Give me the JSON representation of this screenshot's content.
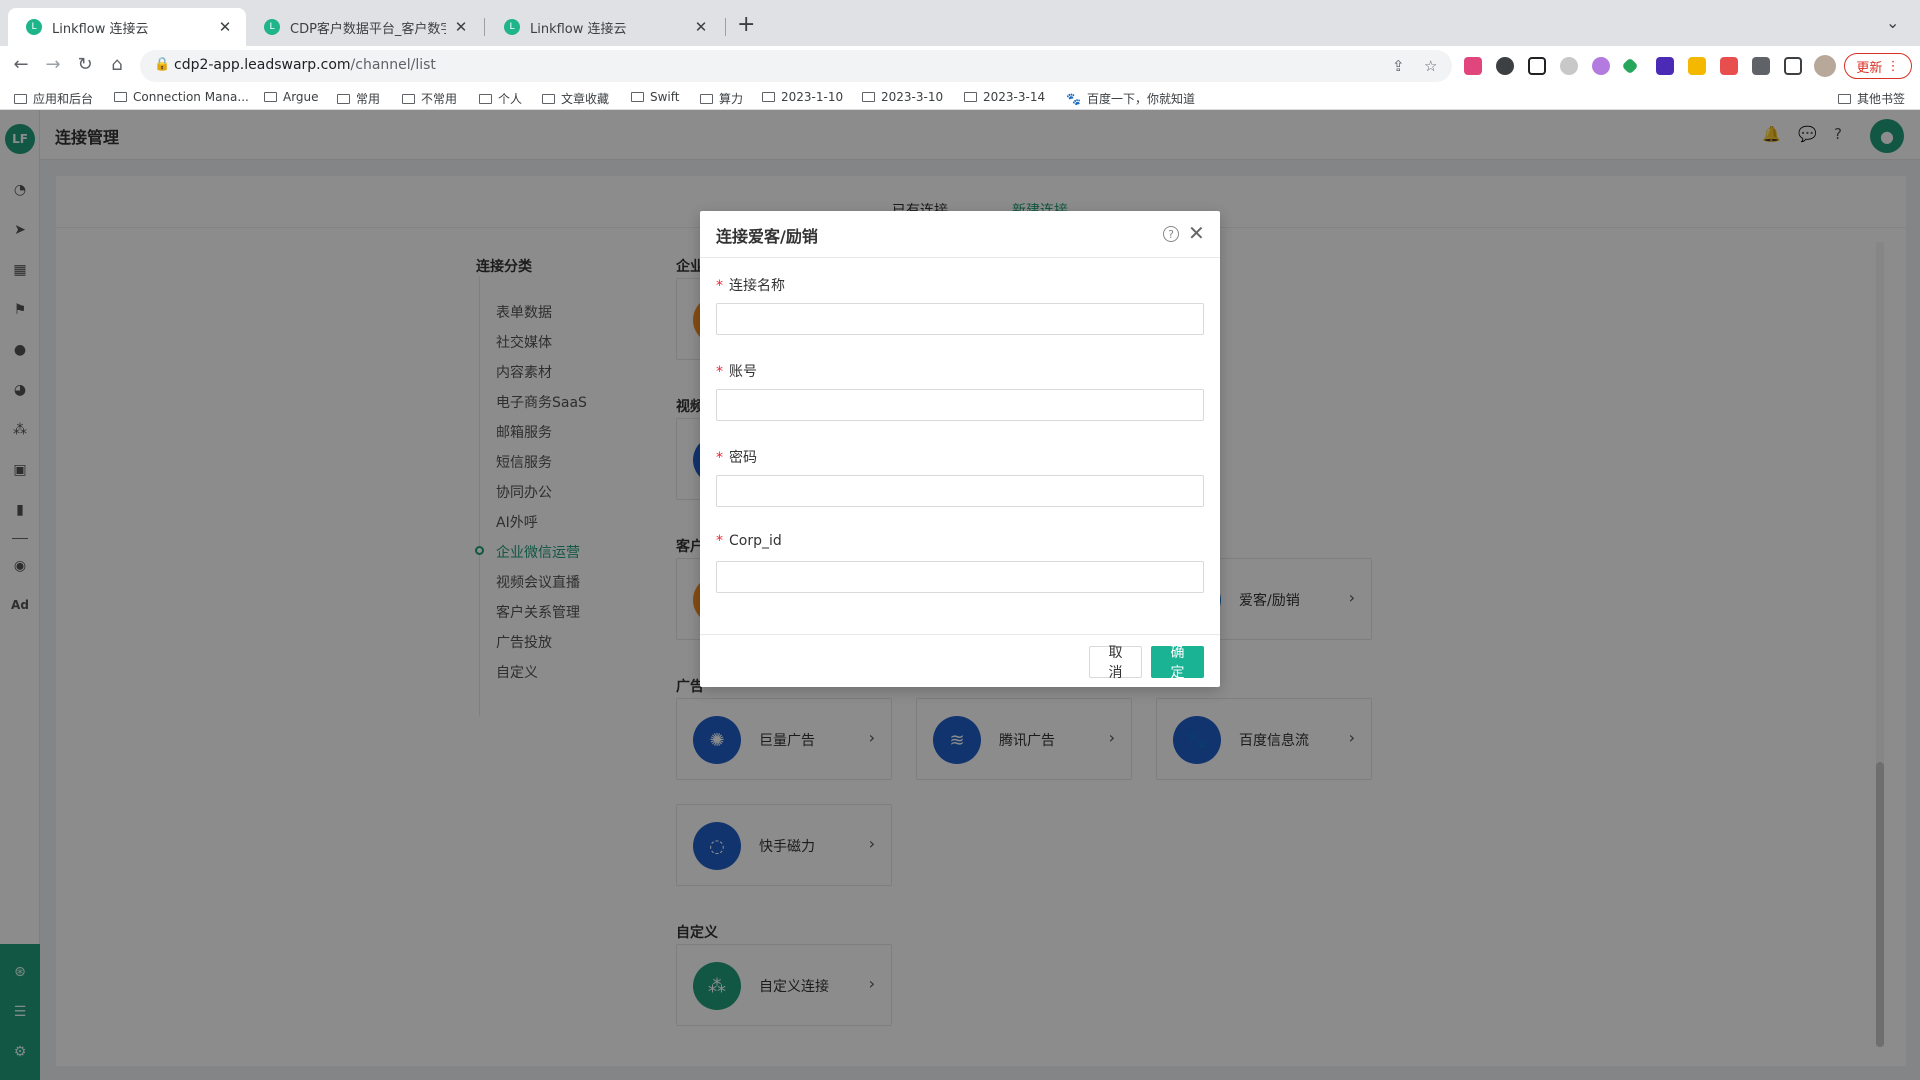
{
  "browser": {
    "tabs": [
      {
        "title": "Linkflow 连接云"
      },
      {
        "title": "CDP客户数据平台_客户数字化全"
      },
      {
        "title": "Linkflow 连接云"
      }
    ],
    "url_host": "cdp2-app.leadswarp.com",
    "url_path": "/channel/list",
    "update_label": "更新",
    "bookmarks": [
      "应用和后台",
      "Connection Mana...",
      "Argue",
      "常用",
      "不常用",
      "个人",
      "文章收藏",
      "Swift",
      "算力",
      "2023-1-10",
      "2023-3-10",
      "2023-3-14",
      "百度一下，你就知道"
    ],
    "other_bookmarks": "其他书签"
  },
  "app": {
    "logo_text": "LF",
    "title": "连接管理",
    "sidebar_text_icon": "Ad",
    "content_tabs": [
      "已有连接",
      "新建连接"
    ],
    "category_title": "连接分类",
    "categories": [
      "表单数据",
      "社交媒体",
      "内容素材",
      "电子商务SaaS",
      "邮箱服务",
      "短信服务",
      "协同办公",
      "AI外呼",
      "企业微信运营",
      "视频会议直播",
      "客户关系管理",
      "广告投放",
      "自定义"
    ],
    "sections": {
      "s1": "企业",
      "s2": "视频",
      "s3": "客户",
      "ads": "广告",
      "custom": "自定义"
    },
    "cards": {
      "aike": "爱客/励销",
      "juliang": "巨量广告",
      "tencent": "腾讯广告",
      "baidu": "百度信息流",
      "kuaishou": "快手磁力",
      "custom": "自定义连接"
    }
  },
  "modal": {
    "title": "连接爱客/励销",
    "required_mark": "*",
    "fields": [
      {
        "label": "连接名称",
        "value": ""
      },
      {
        "label": "账号",
        "value": ""
      },
      {
        "label": "密码",
        "value": ""
      },
      {
        "label": "Corp_id",
        "value": ""
      }
    ],
    "cancel_label": "取消",
    "ok_label": "确定"
  },
  "colors": {
    "brand": "#1f9e7a",
    "primary_button": "#1ab394",
    "required": "#f5222d"
  }
}
